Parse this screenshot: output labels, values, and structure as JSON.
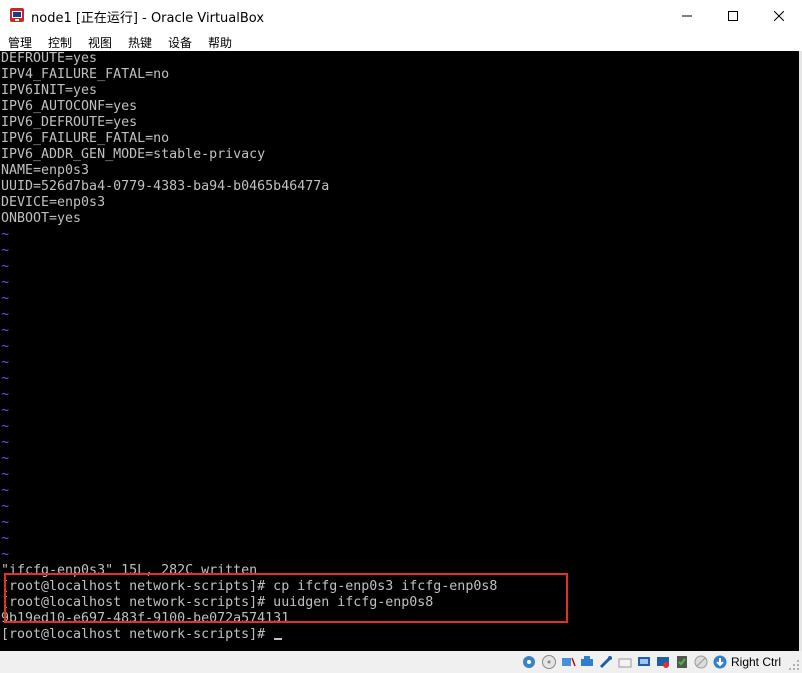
{
  "window": {
    "title": "node1 [正在运行] - Oracle VirtualBox",
    "minimize_glyph": "—",
    "maximize_glyph": "□",
    "close_glyph": "✕"
  },
  "menu": {
    "items": [
      "管理",
      "控制",
      "视图",
      "热键",
      "设备",
      "帮助"
    ]
  },
  "console": {
    "lines": [
      "DEFROUTE=yes",
      "IPV4_FAILURE_FATAL=no",
      "IPV6INIT=yes",
      "IPV6_AUTOCONF=yes",
      "IPV6_DEFROUTE=yes",
      "IPV6_FAILURE_FATAL=no",
      "IPV6_ADDR_GEN_MODE=stable-privacy",
      "NAME=enp0s3",
      "UUID=526d7ba4-0779-4383-ba94-b0465b46477a",
      "DEVICE=enp0s3",
      "ONBOOT=yes"
    ],
    "tilde_char": "~",
    "tilde_count": 21,
    "status_line": "\"ifcfg-enp0s3\" 15L, 282C written",
    "commands": [
      "[root@localhost network-scripts]# cp ifcfg-enp0s3 ifcfg-enp0s8",
      "[root@localhost network-scripts]# uuidgen ifcfg-enp0s8",
      "9b19ed10-e697-483f-9100-be072a574131"
    ],
    "prompt": "[root@localhost network-scripts]# "
  },
  "statusbar": {
    "icons": [
      "hard-disk-icon",
      "optical-drive-icon",
      "audio-icon",
      "network-icon",
      "usb-icon",
      "shared-folder-icon",
      "display-icon",
      "screen-capture-icon",
      "cpu-icon",
      "mouse-integration-icon",
      "keyboard-icon"
    ],
    "host_key": "Right Ctrl"
  },
  "colors": {
    "console_bg": "#000000",
    "console_text": "#c0c0c0",
    "tilde": "#5a5aff",
    "highlight": "#e23030"
  }
}
